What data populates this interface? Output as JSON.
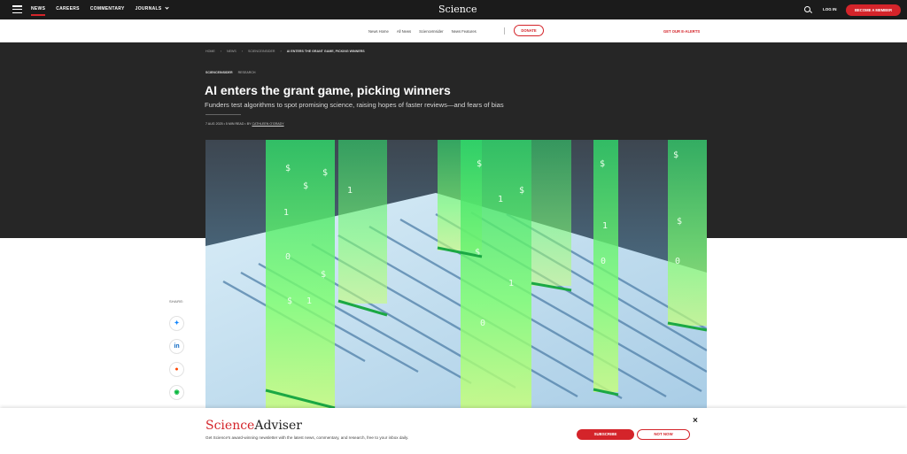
{
  "topbar": {
    "nav": [
      "NEWS",
      "CAREERS",
      "COMMENTARY",
      "JOURNALS"
    ],
    "logo": "Science",
    "login": "LOG IN",
    "member": "BECOME A MEMBER"
  },
  "subnav": {
    "links": [
      "News Home",
      "All News",
      "ScienceInsider",
      "News Features"
    ],
    "donate": "DONATE",
    "ealerts": "GET OUR E-ALERTS"
  },
  "breadcrumb": [
    "HOME",
    "NEWS",
    "SCIENCEINSIDER",
    "AI ENTERS THE GRANT GAME, PICKING WINNERS"
  ],
  "article": {
    "section": "SCIENCEINSIDER",
    "section_label": "RESEARCH",
    "title": "AI enters the grant game, picking winners",
    "dek": "Funders test algorithms to spot promising science, raising hopes of faster reviews—and fears of bias",
    "date": "7 AUG 2025",
    "read": "5 MIN READ",
    "by": "BY",
    "author": "CATHLEEN O'GRADY"
  },
  "share": {
    "label": "SHARE:",
    "buttons": [
      "bluesky-icon",
      "linkedin-icon",
      "reddit-icon",
      "wechat-icon"
    ]
  },
  "adviser": {
    "logo_science": "Science",
    "logo_adviser": "Adviser",
    "text": "Get Science's award-winning newsletter with the latest news, commentary, and research, free to your inbox daily.",
    "subscribe": "SUBSCRIBE",
    "not_now": "NOT NOW",
    "close": "×"
  },
  "colors": {
    "accent": "#d4242a",
    "topbar": "#1b1b1b",
    "hero": "#262626"
  }
}
